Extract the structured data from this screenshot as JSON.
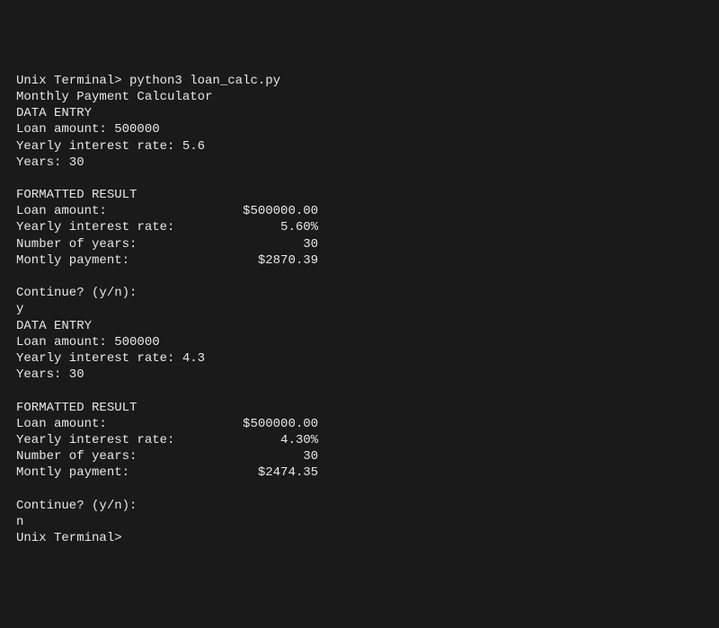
{
  "prompt_prefix": "Unix Terminal> ",
  "command": "python3 loan_calc.py",
  "title": "Monthly Payment Calculator",
  "section_data_entry": "DATA ENTRY",
  "section_result": "FORMATTED RESULT",
  "labels": {
    "loan_amount_entry": "Loan amount: ",
    "yearly_rate_entry": "Yearly interest rate: ",
    "years_entry": "Years: ",
    "loan_amount_result": "Loan amount:",
    "yearly_rate_result": "Yearly interest rate:",
    "num_years_result": "Number of years:",
    "monthly_payment_result": "Montly payment:",
    "continue_prompt": "Continue? (y/n):"
  },
  "runs": [
    {
      "entry": {
        "loan_amount": "500000",
        "yearly_rate": "5.6",
        "years": "30"
      },
      "result": {
        "loan_amount": "$500000.00",
        "yearly_rate": "5.60%",
        "num_years": "30",
        "monthly_payment": "$2870.39"
      },
      "continue_answer": "y"
    },
    {
      "entry": {
        "loan_amount": "500000",
        "yearly_rate": "4.3",
        "years": "30"
      },
      "result": {
        "loan_amount": "$500000.00",
        "yearly_rate": "4.30%",
        "num_years": "30",
        "monthly_payment": "$2474.35"
      },
      "continue_answer": "n"
    }
  ],
  "final_prompt": "Unix Terminal>"
}
